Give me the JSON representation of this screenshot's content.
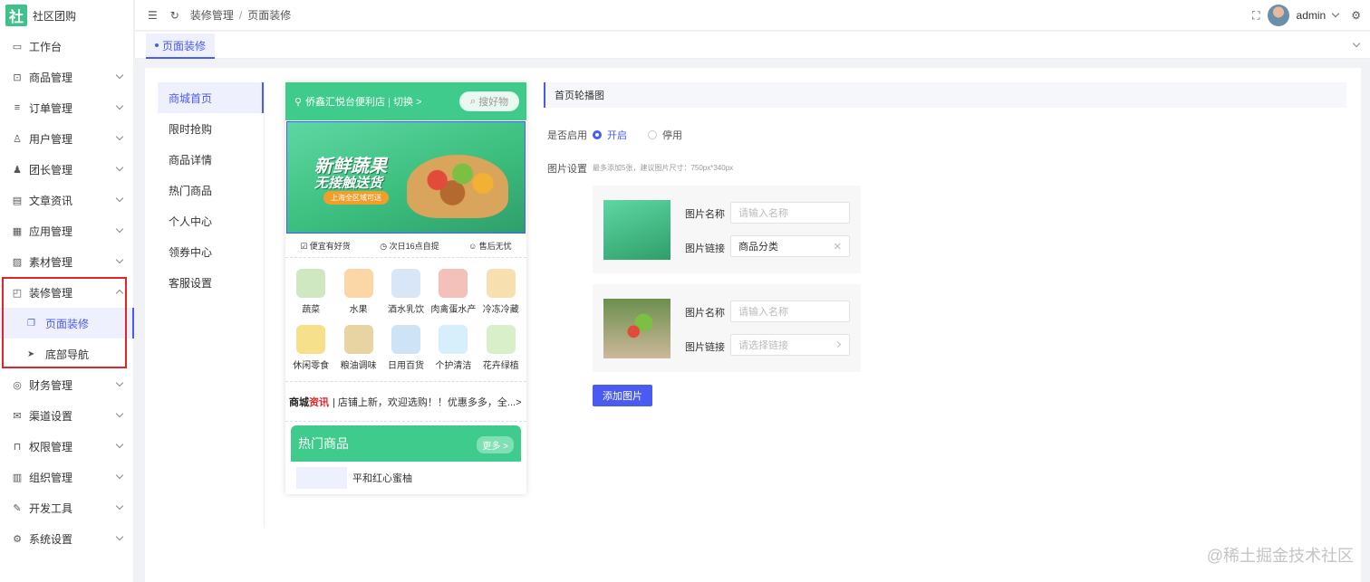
{
  "app": {
    "logo_char": "社",
    "name": "社区团购"
  },
  "sidebar": {
    "items": [
      {
        "label": "工作台",
        "icon": "monitor-icon",
        "glyph": "▭",
        "has_caret": false
      },
      {
        "label": "商品管理",
        "icon": "bag-icon",
        "glyph": "⊡",
        "has_caret": true
      },
      {
        "label": "订单管理",
        "icon": "list-icon",
        "glyph": "≡",
        "has_caret": true
      },
      {
        "label": "用户管理",
        "icon": "user-icon",
        "glyph": "♙",
        "has_caret": true
      },
      {
        "label": "团长管理",
        "icon": "leader-icon",
        "glyph": "♟",
        "has_caret": true
      },
      {
        "label": "文章资讯",
        "icon": "article-icon",
        "glyph": "▤",
        "has_caret": true
      },
      {
        "label": "应用管理",
        "icon": "apps-icon",
        "glyph": "▦",
        "has_caret": true
      },
      {
        "label": "素材管理",
        "icon": "image-icon",
        "glyph": "▨",
        "has_caret": true
      }
    ],
    "decor": {
      "label": "装修管理",
      "icon": "decor-icon",
      "glyph": "◰"
    },
    "decor_sub": [
      {
        "label": "页面装修",
        "icon": "copy-icon",
        "glyph": "❐"
      },
      {
        "label": "底部导航",
        "icon": "send-icon",
        "glyph": "➤"
      }
    ],
    "items_after": [
      {
        "label": "财务管理",
        "icon": "finance-icon",
        "glyph": "◎"
      },
      {
        "label": "渠道设置",
        "icon": "mail-icon",
        "glyph": "✉"
      },
      {
        "label": "权限管理",
        "icon": "lock-icon",
        "glyph": "⊓"
      },
      {
        "label": "组织管理",
        "icon": "org-icon",
        "glyph": "▥"
      },
      {
        "label": "开发工具",
        "icon": "pen-icon",
        "glyph": "✎"
      },
      {
        "label": "系统设置",
        "icon": "gear-icon",
        "glyph": "⚙"
      }
    ]
  },
  "header": {
    "breadcrumb": [
      "装修管理",
      "页面装修"
    ],
    "username": "admin"
  },
  "tabs": [
    {
      "label": "页面装修"
    }
  ],
  "pages": [
    "商城首页",
    "限时抢购",
    "商品详情",
    "热门商品",
    "个人中心",
    "领券中心",
    "客服设置"
  ],
  "preview": {
    "store": "侨鑫汇悦台便利店 | 切换 >",
    "search": "搜好物",
    "banner_title1": "新鲜蔬果",
    "banner_title2": "无接触送货",
    "banner_pill": "上海全区域可送",
    "guarantees": [
      "便宜有好货",
      "次日16点自提",
      "售后无忧"
    ],
    "categories": [
      {
        "label": "蔬菜",
        "color": "#cfe8c2"
      },
      {
        "label": "水果",
        "color": "#fbd7a8"
      },
      {
        "label": "酒水乳饮",
        "color": "#d9e6f7"
      },
      {
        "label": "肉禽蛋水产",
        "color": "#f3c1b9"
      },
      {
        "label": "冷冻冷藏",
        "color": "#f7dfb0"
      },
      {
        "label": "休闲零食",
        "color": "#f6e08b"
      },
      {
        "label": "粮油调味",
        "color": "#e8d3a2"
      },
      {
        "label": "日用百货",
        "color": "#cfe3f7"
      },
      {
        "label": "个护清洁",
        "color": "#d7eefb"
      },
      {
        "label": "花卉绿植",
        "color": "#d8efc9"
      }
    ],
    "news_a": "商城",
    "news_b": "资讯",
    "news_text": "| 店铺上新，欢迎选购！！优惠多多，全...>",
    "hot_title": "热门商品",
    "hot_more": "更多 >",
    "product": "平和红心蜜柚"
  },
  "settings": {
    "section": "首页轮播图",
    "enable_label": "是否启用",
    "on": "开启",
    "off": "停用",
    "image_label": "图片设置",
    "hint": "最多添加5张，建议图片尺寸：750px*340px",
    "cards": [
      {
        "name_label": "图片名称",
        "name_placeholder": "请输入名称",
        "link_label": "图片链接",
        "link_value": "商品分类",
        "link_placeholder": ""
      },
      {
        "name_label": "图片名称",
        "name_placeholder": "请输入名称",
        "link_label": "图片链接",
        "link_value": "",
        "link_placeholder": "请选择链接"
      }
    ],
    "add_button": "添加图片"
  },
  "watermark": "@稀土掘金技术社区",
  "colors": {
    "accent": "#4a5bf0",
    "brand_green": "#3ecb8c",
    "highlight_red": "#e0242b"
  }
}
